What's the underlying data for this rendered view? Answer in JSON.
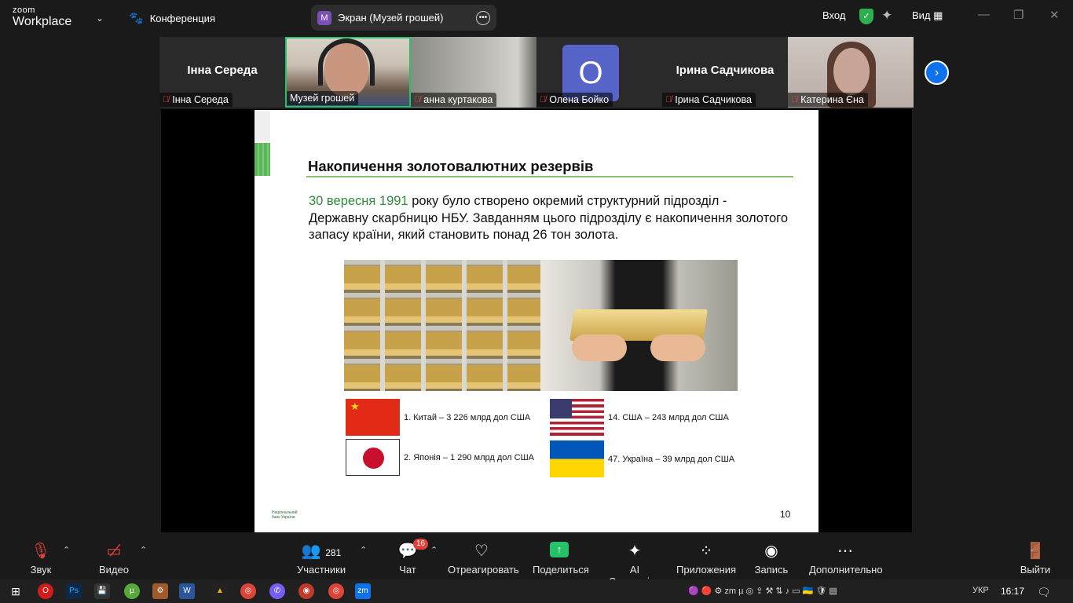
{
  "app": {
    "brand_top": "zoom",
    "brand_bottom": "Workplace"
  },
  "header": {
    "conference_label": "Конференция",
    "share_letter": "M",
    "share_title": "Экран (Музей грошей)",
    "login_label": "Вход",
    "view_label": "Вид"
  },
  "participants": [
    {
      "big_name": "Інна Середа",
      "label": "Інна Середа",
      "muted": true
    },
    {
      "big_name": "",
      "label": "Музей грошей",
      "muted": false,
      "active": true
    },
    {
      "big_name": "",
      "label": "анна куртакова",
      "muted": true
    },
    {
      "big_name": "",
      "label": "Олена Бойко",
      "muted": true,
      "avatar_letter": "О"
    },
    {
      "big_name": "Ірина Садчикова",
      "label": "Ірина Садчикова",
      "muted": true
    },
    {
      "big_name": "",
      "label": "Катерина Єна",
      "muted": true
    }
  ],
  "slide": {
    "title": "Накопичення золотовалютних резервів",
    "date_highlight": "30 вересня 1991",
    "body": " року було створено окремий структурний підрозділ  - Державну скарбницю НБУ. Завданням цього підрозділу є накопичення золотого запасу країни, який становить понад 26 тон золота.",
    "items": [
      {
        "country": "china",
        "text": "1. Китай – 3 226 млрд дол США"
      },
      {
        "country": "usa",
        "text": "14. США – 243 млрд дол США"
      },
      {
        "country": "japan",
        "text": "2. Японія – 1 290 млрд дол США"
      },
      {
        "country": "ukraine",
        "text": "47. Україна – 39 млрд дол США"
      }
    ],
    "logo_text_1": "Національний",
    "logo_text_2": "банк України",
    "page_number": "10"
  },
  "toolbar": {
    "audio": "Звук",
    "video": "Видео",
    "participants": "Участники",
    "participants_count": "281",
    "chat": "Чат",
    "chat_badge": "16",
    "react": "Отреагировать",
    "share": "Поделиться",
    "ai": "AI Companion",
    "apps": "Приложения",
    "record": "Запись",
    "more": "Дополнительно",
    "leave": "Выйти"
  },
  "taskbar": {
    "lang": "УКР",
    "time": "16:17"
  },
  "colors": {
    "accent_green": "#27c16a",
    "zoom_blue": "#0e72ed",
    "slide_green": "#2e8b3a"
  }
}
